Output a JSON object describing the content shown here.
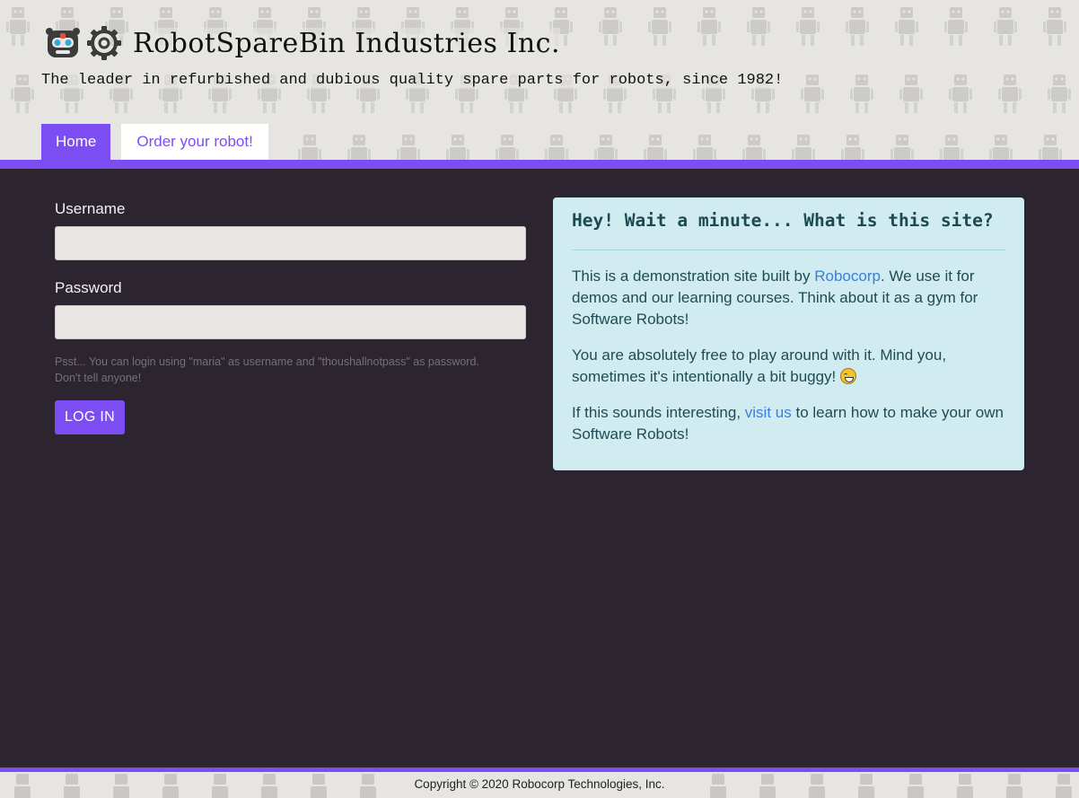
{
  "header": {
    "title": "RobotSpareBin Industries Inc.",
    "tagline": "The leader in refurbished and dubious quality spare parts for robots, since 1982!"
  },
  "nav": {
    "tabs": [
      {
        "label": "Home",
        "active": true
      },
      {
        "label": "Order your robot!",
        "active": false
      }
    ]
  },
  "login": {
    "username_label": "Username",
    "username_value": "",
    "password_label": "Password",
    "password_value": "",
    "hint": "Psst... You can login using \"maria\" as username and \"thoushallnotpass\" as password. Don't tell anyone!",
    "button_label": "LOG IN"
  },
  "info": {
    "title": "Hey! Wait a minute... What is this site?",
    "p1_before": "This is a demonstration site built by ",
    "p1_link": "Robocorp",
    "p1_after": ". We use it for demos and our learning courses. Think about it as a gym for Software Robots!",
    "p2": "You are absolutely free to play around with it. Mind you, sometimes it's intentionally a bit buggy! ",
    "p2_emoji": "grinning-sweat-emoji",
    "p3_before": "If this sounds interesting, ",
    "p3_link": "visit us",
    "p3_after": " to learn how to make your own Software Robots!"
  },
  "footer": {
    "copyright": "Copyright © 2020 Robocorp Technologies, Inc."
  },
  "colors": {
    "accent": "#7c4df2",
    "page_bg": "#2c2530",
    "header_bg": "#e6e5e1",
    "card_bg": "#d1ecf1",
    "link": "#3a7ddb"
  }
}
